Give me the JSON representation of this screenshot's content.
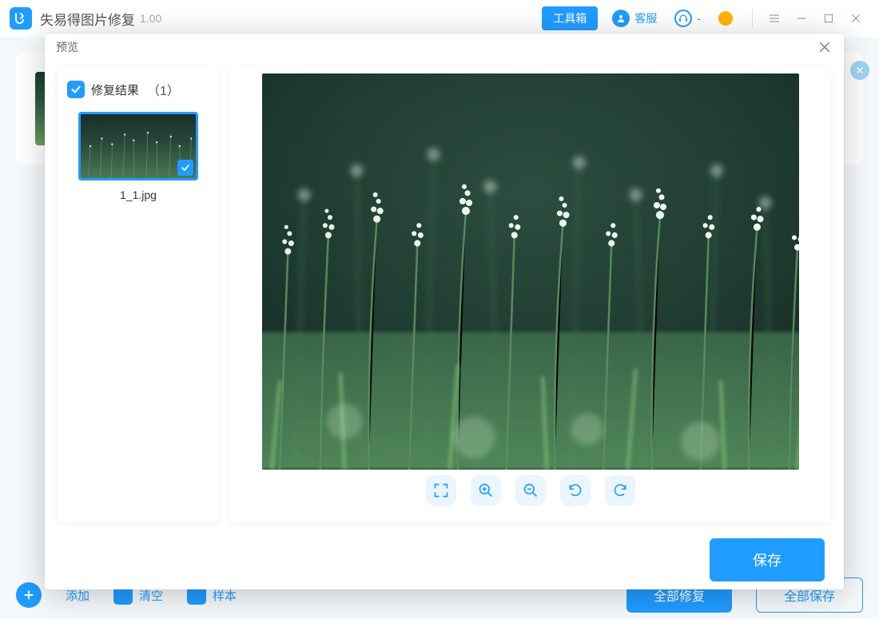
{
  "header": {
    "app_title": "失易得图片修复",
    "app_version": "1.00",
    "toolbox": "工具箱",
    "support": "客服",
    "notifications": "-"
  },
  "modal": {
    "title": "预览",
    "sidebar": {
      "result_label": "修复结果",
      "result_count": "（1）",
      "items": [
        {
          "filename": "1_1.jpg",
          "selected": true
        }
      ]
    },
    "toolbar": {
      "fullscreen": "fullscreen",
      "zoom_in": "zoom-in",
      "zoom_out": "zoom-out",
      "rotate_left": "rotate-left",
      "rotate_right": "rotate-right"
    },
    "save_label": "保存"
  },
  "background": {
    "actions": {
      "add": "添加",
      "clear": "清空",
      "sample": "样本"
    },
    "repair_all": "全部修复",
    "save_all": "全部保存"
  }
}
